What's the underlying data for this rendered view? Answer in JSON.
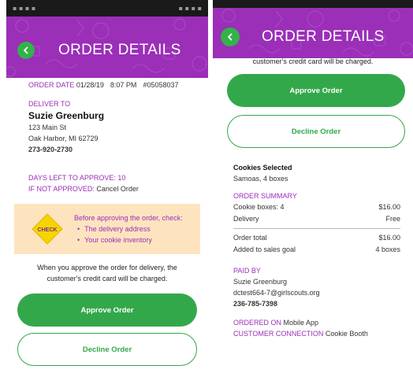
{
  "screen1": {
    "header_title": "ORDER DETAILS",
    "order_date_label": "ORDER DATE",
    "order_date": "01/28/19",
    "order_time": "8:07 PM",
    "order_number": "#05058037",
    "deliver_to_label": "DELIVER TO",
    "customer_name": "Suzie Greenburg",
    "address_line1": "123 Main St",
    "address_line2": "Oak Harbor, MI 62729",
    "phone": "273-920-2730",
    "days_left": "DAYS LEFT TO APPROVE: 10",
    "not_approved_label": "IF NOT APPROVED:",
    "not_approved_action": "Cancel Order",
    "check_badge": "CHECK",
    "check_intro": "Before approving the order, check:",
    "check_items": [
      "The delivery address",
      "Your cookie inventory"
    ],
    "notice": "When you approve the order for delivery, the customer's credit card will be charged.",
    "approve_label": "Approve Order",
    "decline_label": "Decline Order"
  },
  "screen2": {
    "header_title": "ORDER DETAILS",
    "partial_notice": "customer's credit card will be charged.",
    "approve_label": "Approve Order",
    "decline_label": "Decline Order",
    "cookies_selected_label": "Cookies Selected",
    "cookies_selected_value": "Samoas, 4 boxes",
    "order_summary_label": "ORDER SUMMARY",
    "summary_rows": [
      {
        "label": "Cookie boxes: 4",
        "value": "$16.00"
      },
      {
        "label": "Delivery",
        "value": "Free"
      }
    ],
    "total_rows": [
      {
        "label": "Order total",
        "value": "$16.00"
      },
      {
        "label": "Added to sales goal",
        "value": "4 boxes"
      }
    ],
    "paid_by_label": "PAID BY",
    "payer_name": "Suzie Greenburg",
    "payer_email": "dctest664-7@girlscouts.org",
    "payer_phone": "236-785-7398",
    "ordered_on_label": "ORDERED ON",
    "ordered_on_value": "Mobile App",
    "connection_label": "CUSTOMER CONNECTION",
    "connection_value": "Cookie Booth"
  },
  "colors": {
    "header_purple": "#9b2fb8",
    "accent_green": "#33a84a",
    "callout_bg": "#fde4bf",
    "check_yellow": "#f5d400"
  },
  "icons": [
    "back-arrow-icon",
    "check-diamond-icon"
  ]
}
